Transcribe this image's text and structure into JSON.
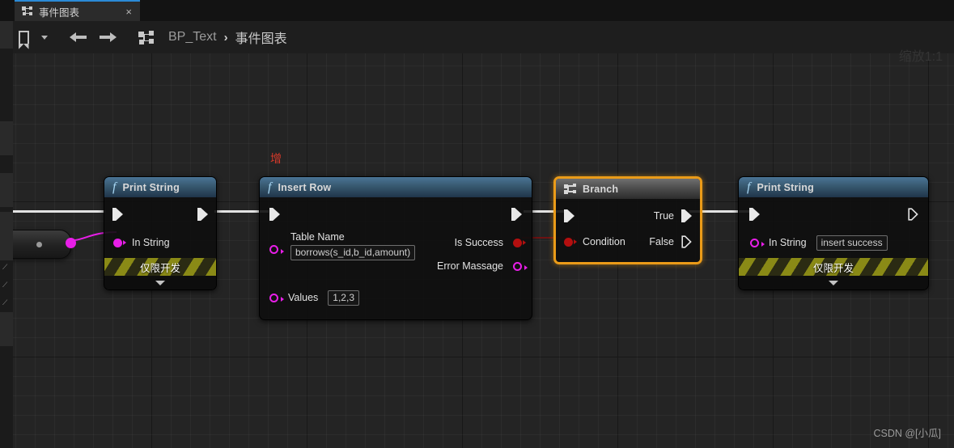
{
  "tab": {
    "icon": "graph-icon",
    "label": "事件图表",
    "close_label": "×"
  },
  "toolbar": {
    "bookmark_label": "bookmark-icon",
    "dropdown_label": "chevron-down-icon",
    "back_label": "back-arrow-icon",
    "forward_label": "forward-arrow-icon",
    "graph_icon_label": "graph-icon",
    "breadcrumb": {
      "root": "BP_Text",
      "separator": "›",
      "current": "事件图表"
    }
  },
  "canvas": {
    "zoom_label": "缩放1:1",
    "watermark": "CSDN @[小瓜]",
    "annotation": "增"
  },
  "nodes": {
    "print_string_1": {
      "title": "Print String",
      "icon": "function-icon",
      "in_string_label": "In String",
      "dev_only_label": "仅限开发"
    },
    "insert_row": {
      "title": "Insert Row",
      "icon": "function-icon",
      "table_name_label": "Table Name",
      "table_name_value": "borrows(s_id,b_id,amount)",
      "values_label": "Values",
      "values_value": "1,2,3",
      "is_success_label": "Is Success",
      "error_message_label": "Error Massage"
    },
    "branch": {
      "title": "Branch",
      "icon": "branch-icon",
      "condition_label": "Condition",
      "true_label": "True",
      "false_label": "False"
    },
    "print_string_2": {
      "title": "Print String",
      "icon": "function-icon",
      "in_string_label": "In String",
      "in_string_value": "insert success",
      "dev_only_label": "仅限开发"
    }
  },
  "colors": {
    "exec_wire": "#e2e2e2",
    "bool_pin": "#b40f0f",
    "string_pin": "#e81ee8",
    "selection": "#eb9b18",
    "tab_accent": "#2b8ad6"
  }
}
